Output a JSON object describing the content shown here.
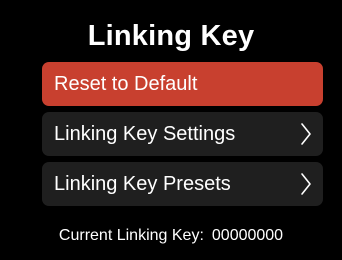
{
  "title": "Linking Key",
  "menu": {
    "items": [
      {
        "label": "Reset to Default",
        "selected": true
      },
      {
        "label": "Linking Key Settings",
        "icon": "chevron-right-icon"
      },
      {
        "label": "Linking Key Presets",
        "icon": "chevron-right-icon"
      }
    ]
  },
  "footer": {
    "label": "Current Linking Key:",
    "value": "00000000"
  },
  "colors": {
    "background": "#000000",
    "item_background": "#1f1f1f",
    "selected_background": "#c8402f",
    "text": "#ffffff"
  }
}
